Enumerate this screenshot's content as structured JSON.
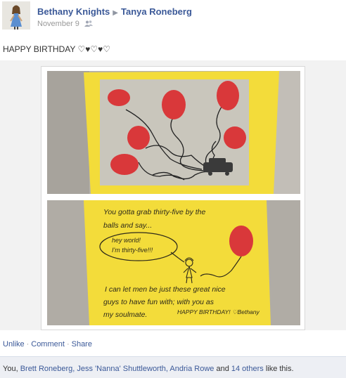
{
  "post": {
    "author": "Bethany Knights",
    "target": "Tanya Roneberg",
    "date": "November 9",
    "message": "HAPPY BIRTHDAY ♡♥♡♥♡",
    "privacy_icon": "friends-icon",
    "arrow_icon": "share-arrow-icon"
  },
  "card_text": {
    "line1": "You gotta grab thirty-five by the",
    "line2": "balls and say...",
    "bubble1": "hey world!",
    "bubble2": "I'm thirty-five!!!",
    "line3": "I can let men be just these great nice",
    "line4": "guys to have fun with; with you as",
    "line5": "my soulmate.",
    "line6": "HAPPY BIRTHDAY! ♡Bethany"
  },
  "actions": {
    "unlike": "Unlike",
    "comment": "Comment",
    "share": "Share",
    "separator": "·"
  },
  "likes": {
    "you": "You,",
    "person1": "Brett Roneberg,",
    "person2": "Jess 'Nanna' Shuttleworth,",
    "person3": "Andria Rowe",
    "and": "and",
    "others": "14 others",
    "suffix": "like this."
  },
  "colors": {
    "link": "#3b5998",
    "card_yellow": "#f3dc3a",
    "balloon_red": "#d9383a",
    "likes_bg": "#edeff4"
  }
}
